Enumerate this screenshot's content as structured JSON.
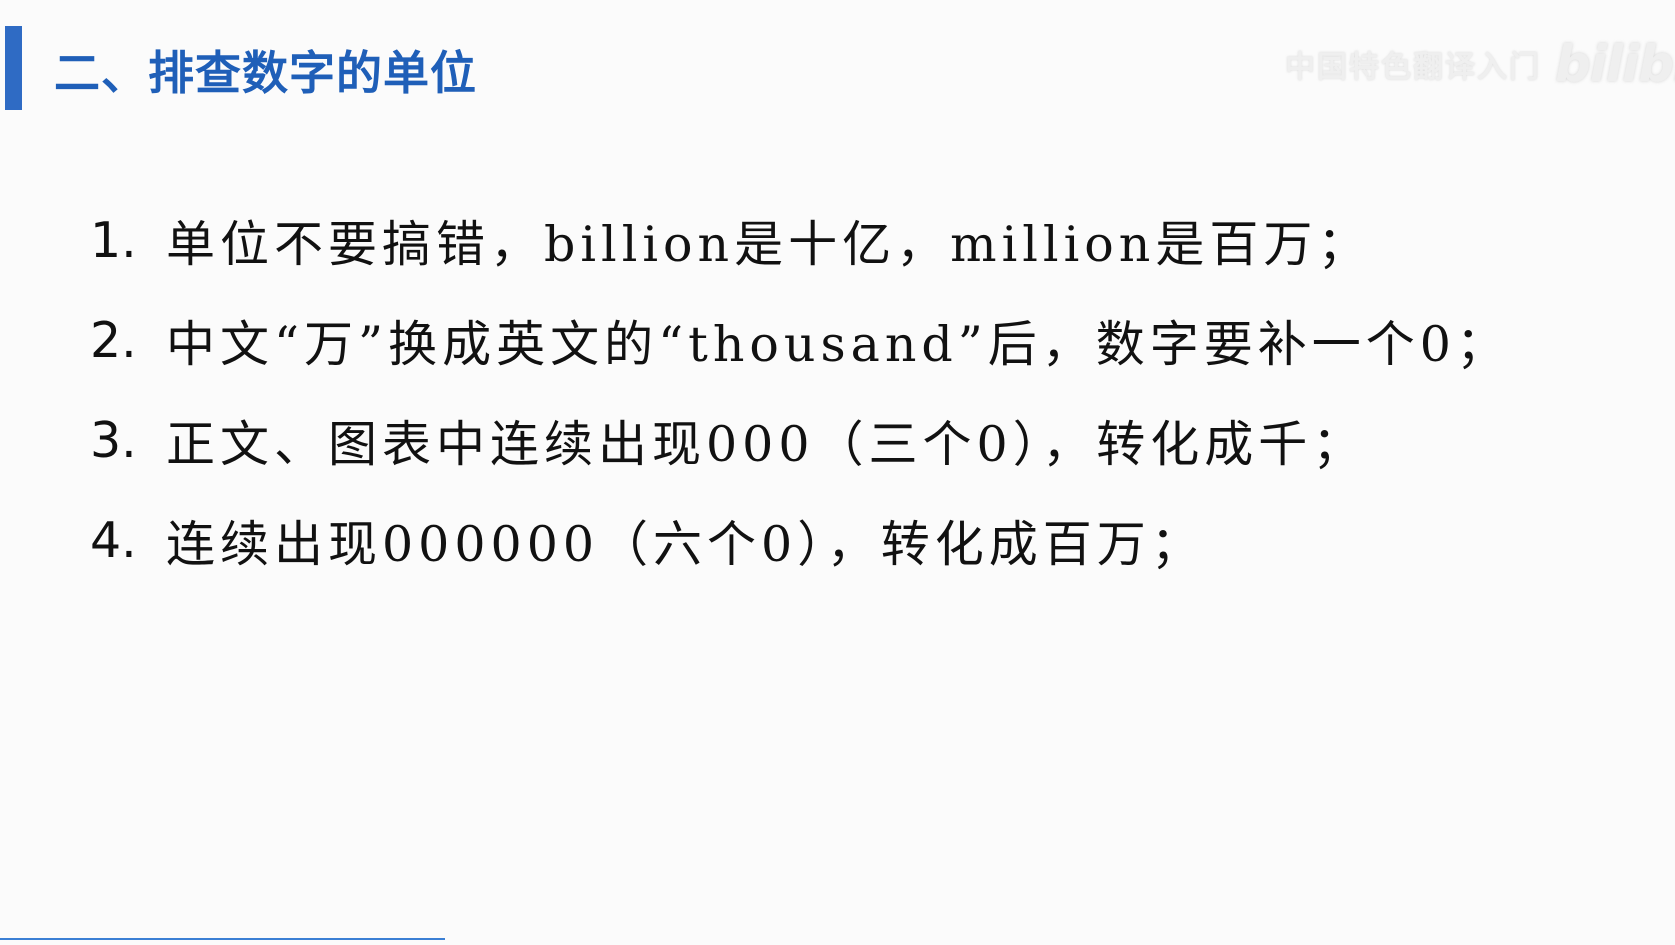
{
  "colors": {
    "accent": "#2f6bc4",
    "title": "#1f5fb8",
    "watermark": "#e6e6e6",
    "bottom_line": "#3b7fd4"
  },
  "slide": {
    "title": "二、排查数字的单位",
    "watermark_text": "中国特色翻译入门",
    "watermark_logo": "bilibili"
  },
  "items": [
    {
      "number": "1.",
      "text": "单位不要搞错，billion是十亿，million是百万；"
    },
    {
      "number": "2.",
      "text": "中文“万”换成英文的“thousand”后，数字要补一个0；"
    },
    {
      "number": "3.",
      "text": "正文、图表中连续出现000（三个0），转化成千；"
    },
    {
      "number": "4.",
      "text": "连续出现000000（六个0），转化成百万；"
    }
  ]
}
